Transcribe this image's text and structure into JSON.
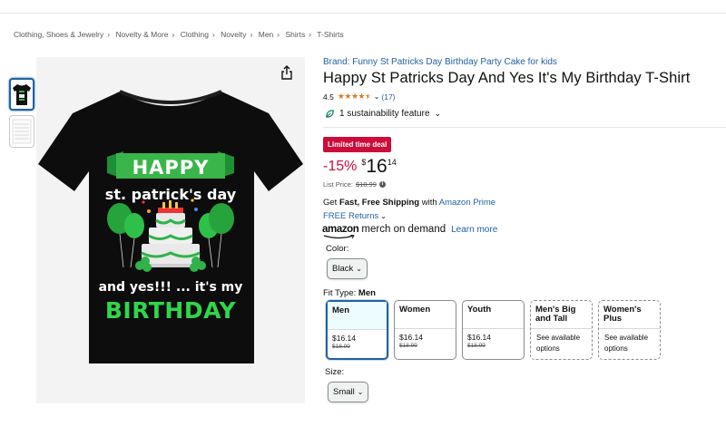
{
  "breadcrumb": [
    "Clothing, Shoes & Jewelry",
    "Novelty & More",
    "Clothing",
    "Novelty",
    "Men",
    "Shirts",
    "T-Shirts"
  ],
  "breadcrumb_separator": "›",
  "shirt": {
    "line1": "HAPPY",
    "line2": "st. patrick's day",
    "line3": "and yes!!! ... it's my",
    "line4": "BIRTHDAY"
  },
  "product": {
    "brand_link": "Brand: Funny St Patricks Day Birthday Party Cake for kids",
    "title": "Happy St Patricks Day And Yes It's My Birthday T-Shirt",
    "rating_value": "4.5",
    "rating_stars": 4.5,
    "rating_count": "(17)",
    "sustainability": "1 sustainability feature"
  },
  "deal_badge": "Limited time deal",
  "price": {
    "discount": "-15%",
    "currency": "$",
    "whole": "16",
    "fraction": "14",
    "list_label": "List Price:",
    "list_value": "$18.99"
  },
  "shipping": {
    "prefix": "Get ",
    "bold": "Fast, Free Shipping",
    "mid": " with ",
    "prime": "Amazon Prime"
  },
  "returns": "FREE Returns",
  "mod": {
    "amazon": "amazon",
    "rest": "merch on demand",
    "learn": "Learn more"
  },
  "color": {
    "label": "Color:",
    "value": "Black"
  },
  "fit": {
    "label": "Fit Type:",
    "value": "Men",
    "options": [
      {
        "name": "Men",
        "price": "$16.14",
        "old": "$18.99"
      },
      {
        "name": "Women",
        "price": "$16.14",
        "old": "$18.99"
      },
      {
        "name": "Youth",
        "price": "$16.14",
        "old": "$18.99"
      },
      {
        "name": "Men's Big and Tall",
        "availability": "See available options"
      },
      {
        "name": "Women's Plus",
        "availability": "See available options"
      }
    ]
  },
  "size": {
    "label": "Size:",
    "value": "Small"
  },
  "colors": {
    "link": "#2162a1",
    "deal": "#cc0c39",
    "star": "#de7921",
    "shirt_green": "#2fb34a"
  },
  "icons": [
    "share-icon",
    "leaf-icon",
    "chevron-down-icon",
    "info-icon",
    "star-icon"
  ]
}
